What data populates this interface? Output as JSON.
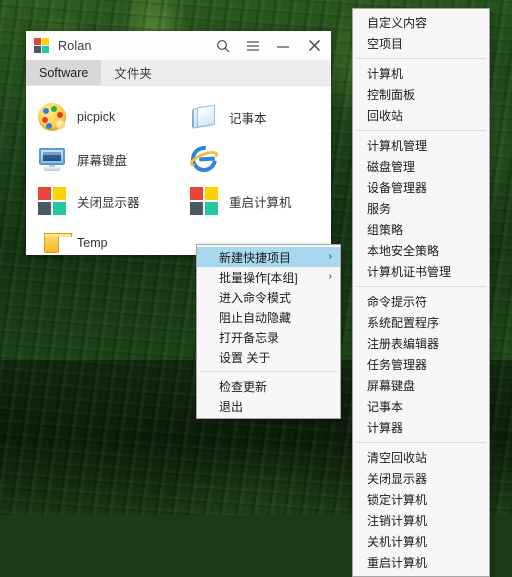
{
  "desktop": {
    "wallpaper_name": "forest-wallpaper"
  },
  "window": {
    "title": "Rolan",
    "logo_colors": [
      "#e8443a",
      "#ffd200",
      "#4a5a64",
      "#23c8a0"
    ],
    "titlebar_buttons": [
      {
        "name": "search-icon",
        "label": "⌕"
      },
      {
        "name": "menu-icon",
        "label": "≡"
      },
      {
        "name": "minimize-icon",
        "label": "–"
      },
      {
        "name": "close-icon",
        "label": "✕"
      }
    ],
    "tabs": [
      {
        "label": "Software",
        "active": true
      },
      {
        "label": "文件夹",
        "active": false
      }
    ],
    "items": [
      {
        "label": "picpick",
        "icon": "picpick-icon"
      },
      {
        "label": "记事本",
        "icon": "notepad-icon"
      },
      {
        "label": "屏幕键盘",
        "icon": "onscreen-keyboard-icon"
      },
      {
        "label": "Internet Explorer",
        "icon": "internet-explorer-icon",
        "label_hidden": true
      },
      {
        "label": "关闭显示器",
        "icon": "rolan-squares-icon"
      },
      {
        "label": "重启计算机",
        "icon": "rolan-squares-icon"
      },
      {
        "label": "Temp",
        "icon": "folder-icon"
      }
    ]
  },
  "context_menu": {
    "items": [
      {
        "label": "新建快捷项目",
        "submenu": true,
        "highlight": true,
        "arrow": "›"
      },
      {
        "label": "批量操作[本组]",
        "submenu": true,
        "highlight": false,
        "arrow": "›"
      },
      {
        "label": "进入命令模式",
        "submenu": false,
        "highlight": false
      },
      {
        "label": "阻止自动隐藏",
        "submenu": false,
        "highlight": false
      },
      {
        "label": "打开备忘录",
        "submenu": false,
        "highlight": false
      },
      {
        "label": "设置  关于",
        "submenu": false,
        "highlight": false
      },
      {
        "separator": true
      },
      {
        "label": "检查更新",
        "submenu": false,
        "highlight": false
      },
      {
        "label": "退出",
        "submenu": false,
        "highlight": false
      }
    ]
  },
  "submenu": {
    "items": [
      {
        "label": "自定义内容"
      },
      {
        "label": "空项目"
      },
      {
        "separator": true
      },
      {
        "label": "计算机"
      },
      {
        "label": "控制面板"
      },
      {
        "label": "回收站"
      },
      {
        "separator": true
      },
      {
        "label": "计算机管理"
      },
      {
        "label": "磁盘管理"
      },
      {
        "label": "设备管理器"
      },
      {
        "label": "服务"
      },
      {
        "label": "组策略"
      },
      {
        "label": "本地安全策略"
      },
      {
        "label": "计算机证书管理"
      },
      {
        "separator": true
      },
      {
        "label": "命令提示符"
      },
      {
        "label": "系统配置程序"
      },
      {
        "label": "注册表编辑器"
      },
      {
        "label": "任务管理器"
      },
      {
        "label": "屏幕键盘"
      },
      {
        "label": "记事本"
      },
      {
        "label": "计算器"
      },
      {
        "separator": true
      },
      {
        "label": "清空回收站"
      },
      {
        "label": "关闭显示器"
      },
      {
        "label": "锁定计算机"
      },
      {
        "label": "注销计算机"
      },
      {
        "label": "关机计算机"
      },
      {
        "label": "重启计算机"
      }
    ]
  }
}
